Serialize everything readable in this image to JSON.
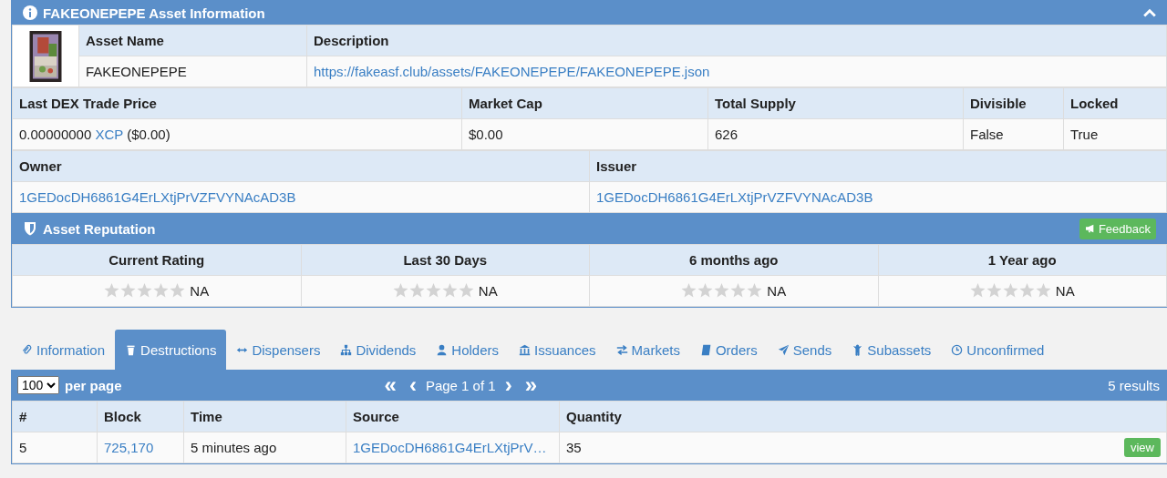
{
  "asset_panel": {
    "title": "FAKEONEPEPE Asset Information",
    "expanded": true,
    "asset_name_label": "Asset Name",
    "description_label": "Description",
    "asset_name": "FAKEONEPEPE",
    "description": "https://fakeasf.club/assets/FAKEONEPEPE/FAKEONEPEPE.json",
    "stats_columns": [
      "Last DEX Trade Price",
      "Market Cap",
      "Total Supply",
      "Divisible",
      "Locked"
    ],
    "price": "0.00000000",
    "price_currency": "XCP",
    "price_usd": "($0.00)",
    "market_cap": "$0.00",
    "total_supply": "626",
    "divisible": "False",
    "locked": "True",
    "owner_label": "Owner",
    "issuer_label": "Issuer",
    "owner": "1GEDocDH6861G4ErLXtjPrVZFVYNAcAD3B",
    "issuer": "1GEDocDH6861G4ErLXtjPrVZFVYNAcAD3B"
  },
  "reputation": {
    "title": "Asset Reputation",
    "feedback_button": "Feedback",
    "ratings": [
      {
        "label": "Current Rating",
        "stars": 0,
        "value": "NA"
      },
      {
        "label": "Last 30 Days",
        "stars": 0,
        "value": "NA"
      },
      {
        "label": "6 months ago",
        "stars": 0,
        "value": "NA"
      },
      {
        "label": "1 Year ago",
        "stars": 0,
        "value": "NA"
      }
    ]
  },
  "tabs": [
    {
      "label": "Information",
      "selected": false
    },
    {
      "label": "Destructions",
      "selected": true
    },
    {
      "label": "Dispensers",
      "selected": false
    },
    {
      "label": "Dividends",
      "selected": false
    },
    {
      "label": "Holders",
      "selected": false
    },
    {
      "label": "Issuances",
      "selected": false
    },
    {
      "label": "Markets",
      "selected": false
    },
    {
      "label": "Orders",
      "selected": false
    },
    {
      "label": "Sends",
      "selected": false
    },
    {
      "label": "Subassets",
      "selected": false
    },
    {
      "label": "Unconfirmed",
      "selected": false
    }
  ],
  "results": {
    "per_page_value": "100",
    "per_page_label": "per page",
    "first": "«",
    "prev": "‹",
    "page": "Page 1 of 1",
    "next": "›",
    "last": "»",
    "count": "5 results",
    "columns": [
      "#",
      "Block",
      "Time",
      "Source",
      "Quantity"
    ],
    "rows": [
      {
        "cells": [
          "5",
          "725,170",
          "5 minutes ago",
          "1GEDocDH6861G4ErLXtjPrV…",
          "35"
        ],
        "action": "view"
      }
    ]
  }
}
